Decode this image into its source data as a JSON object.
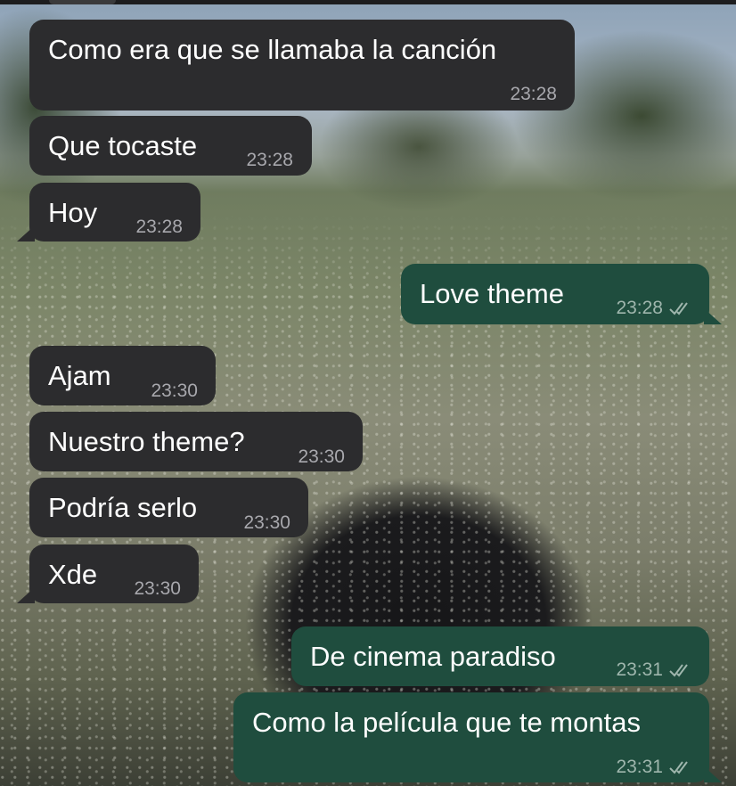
{
  "messages": [
    {
      "side": "in",
      "text": "Como era que se llamaba la canción",
      "time": "23:28"
    },
    {
      "side": "in",
      "text": "Que tocaste",
      "time": "23:28"
    },
    {
      "side": "in",
      "text": "Hoy",
      "time": "23:28"
    },
    {
      "side": "out",
      "text": "Love theme",
      "time": "23:28",
      "status": "read"
    },
    {
      "side": "in",
      "text": "Ajam",
      "time": "23:30"
    },
    {
      "side": "in",
      "text": "Nuestro theme?",
      "time": "23:30"
    },
    {
      "side": "in",
      "text": "Podría serlo",
      "time": "23:30"
    },
    {
      "side": "in",
      "text": "Xde",
      "time": "23:30"
    },
    {
      "side": "out",
      "text": "De cinema paradiso",
      "time": "23:31",
      "status": "read"
    },
    {
      "side": "out",
      "text": "Como la película que te montas",
      "time": "23:31",
      "status": "read"
    }
  ],
  "colors": {
    "incoming_bubble": "#2c2c2e",
    "outgoing_bubble": "#1f4d3e",
    "text": "#ffffff",
    "timestamp": "#a8a8ad"
  },
  "icons": {
    "read_receipt": "double-check-icon"
  }
}
